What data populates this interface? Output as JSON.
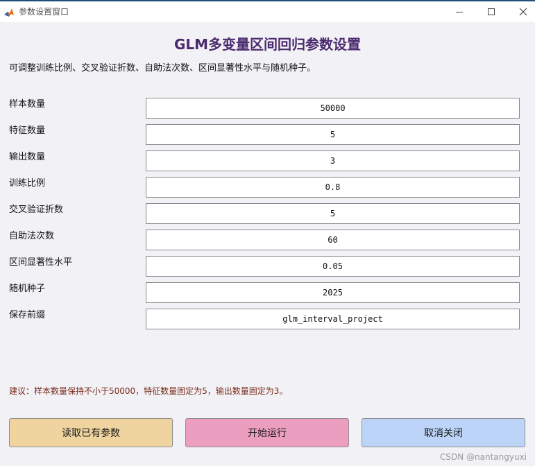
{
  "window": {
    "title": "参数设置窗口",
    "icon": "matlab-icon"
  },
  "header": {
    "title": "GLM多变量区间回归参数设置",
    "description": "可调整训练比例、交叉验证折数、自助法次数、区间显著性水平与随机种子。"
  },
  "params": [
    {
      "label": "样本数量",
      "value": "50000"
    },
    {
      "label": "特征数量",
      "value": "5"
    },
    {
      "label": "输出数量",
      "value": "3"
    },
    {
      "label": "训练比例",
      "value": "0.8"
    },
    {
      "label": "交叉验证折数",
      "value": "5"
    },
    {
      "label": "自助法次数",
      "value": "60"
    },
    {
      "label": "区间显著性水平",
      "value": "0.05"
    },
    {
      "label": "随机种子",
      "value": "2025"
    },
    {
      "label": "保存前缀",
      "value": "glm_interval_project"
    }
  ],
  "advice": "建议：样本数量保持不小于50000，特征数量固定为5，输出数量固定为3。",
  "buttons": {
    "load": "读取已有参数",
    "run": "开始运行",
    "cancel": "取消关闭"
  },
  "colors": {
    "title": "#4b2a6e",
    "advice": "#7a2a1a",
    "load_button": "#f0d4a0",
    "run_button": "#ec9ec0",
    "cancel_button": "#bcd4f8"
  },
  "watermark": "CSDN @nantangyuxi"
}
